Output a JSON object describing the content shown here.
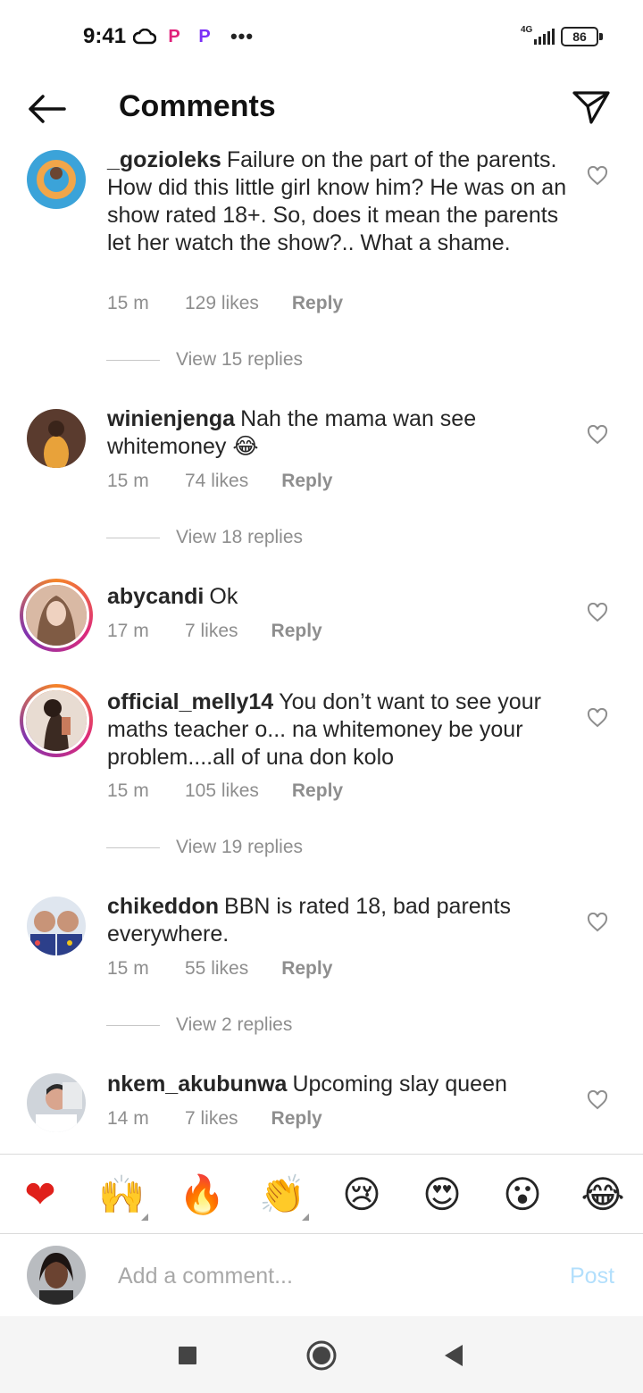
{
  "status_bar": {
    "time": "9:41",
    "network": "4G",
    "battery": "86",
    "icons": [
      "cloud-icon",
      "p-app-icon",
      "p-app-icon",
      "more-dots-icon",
      "signal-icon",
      "battery-icon"
    ]
  },
  "header": {
    "title": "Comments",
    "back_icon": "arrow-left-icon",
    "send_icon": "paper-plane-icon"
  },
  "comments": [
    {
      "username": "_gozioleks",
      "text": "Failure on the part of the parents. How did this little girl know him? He was on an show rated 18+. So, does it mean the parents let her watch the show?.. What a shame.",
      "time": "15 m",
      "likes": "129 likes",
      "reply": "Reply",
      "view_replies": "View 15 replies"
    },
    {
      "username": "winienjenga",
      "text": "Nah the mama wan see whitemoney 😂",
      "time": "15 m",
      "likes": "74 likes",
      "reply": "Reply",
      "view_replies": "View 18 replies"
    },
    {
      "username": "abycandi",
      "text": "Ok",
      "time": "17 m",
      "likes": "7 likes",
      "reply": "Reply"
    },
    {
      "username": "official_melly14",
      "text": "You don’t want to see your maths teacher o... na whitemoney be your problem....all of una don kolo",
      "time": "15 m",
      "likes": "105 likes",
      "reply": "Reply",
      "view_replies": "View 19 replies"
    },
    {
      "username": "chikeddon",
      "text": "BBN is rated 18, bad parents everywhere.",
      "time": "15 m",
      "likes": "55 likes",
      "reply": "Reply",
      "view_replies": "View 2 replies"
    },
    {
      "username": "nkem_akubunwa",
      "text": "Upcoming slay queen",
      "time": "14 m",
      "likes": "7 likes",
      "reply": "Reply"
    }
  ],
  "emoji_bar": [
    "❤",
    "🙌",
    "🔥",
    "👏",
    "😢",
    "😍",
    "😮",
    "😂"
  ],
  "add_comment": {
    "placeholder": "Add a comment...",
    "post_label": "Post"
  },
  "nav_bar": {
    "icons": [
      "recents-square-icon",
      "home-circle-icon",
      "back-triangle-icon"
    ]
  },
  "colors": {
    "text": "#262626",
    "secondary": "#8e8e8e",
    "post_disabled": "#b2dffc",
    "heart_red": "#e0201b"
  }
}
